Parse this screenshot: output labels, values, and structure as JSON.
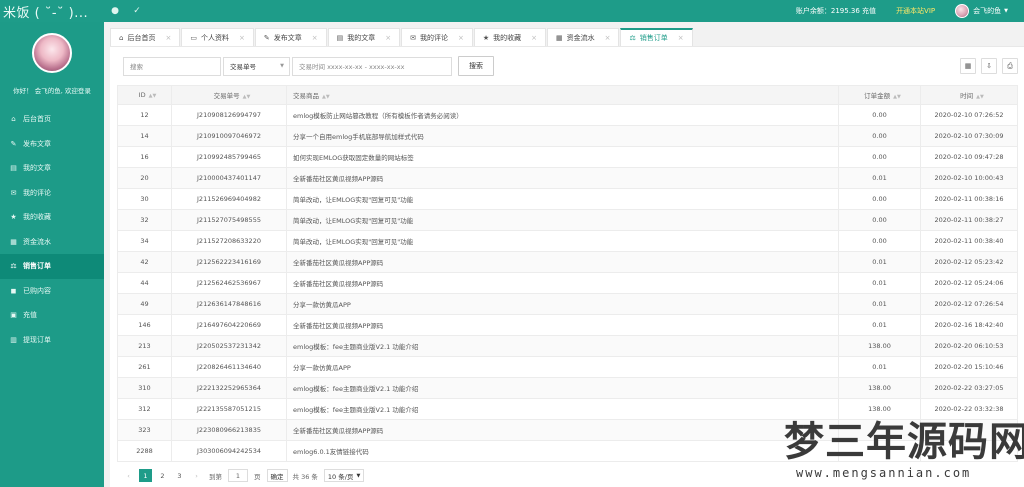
{
  "topbar": {
    "brand": "米饭 ( ˘-˘ )...",
    "icons": [
      "circle-icon",
      "check-icon"
    ],
    "balance": "账户余额：2195.36 充值",
    "vip": "开通本站VIP",
    "username": "会飞的鱼"
  },
  "sidebar": {
    "greeting": "你好！ 会飞的鱼, 欢迎登录",
    "items": [
      {
        "label": "后台首页",
        "icon": "home-icon"
      },
      {
        "label": "发布文章",
        "icon": "edit-icon"
      },
      {
        "label": "我的文章",
        "icon": "book-icon"
      },
      {
        "label": "我的评论",
        "icon": "comment-icon"
      },
      {
        "label": "我的收藏",
        "icon": "star-icon"
      },
      {
        "label": "资金流水",
        "icon": "calculator-icon"
      },
      {
        "label": "销售订单",
        "icon": "balance-icon",
        "active": true
      },
      {
        "label": "已购内容",
        "icon": "bag-icon"
      },
      {
        "label": "充值",
        "icon": "lock-icon"
      },
      {
        "label": "提现订单",
        "icon": "wallet-icon"
      }
    ]
  },
  "tabs": [
    {
      "label": "后台首页",
      "icon": "home-icon"
    },
    {
      "label": "个人资料",
      "icon": "card-icon"
    },
    {
      "label": "发布文章",
      "icon": "edit-icon"
    },
    {
      "label": "我的文章",
      "icon": "book-icon"
    },
    {
      "label": "我的评论",
      "icon": "comment-icon"
    },
    {
      "label": "我的收藏",
      "icon": "star-icon"
    },
    {
      "label": "资金流水",
      "icon": "calculator-icon"
    },
    {
      "label": "销售订单",
      "icon": "balance-icon",
      "active": true
    }
  ],
  "search": {
    "keyword_placeholder": "搜索",
    "field_select": "交易单号",
    "time_placeholder": "交易时间 xxxx-xx-xx - xxxx-xx-xx",
    "button": "搜索"
  },
  "table": {
    "headers": [
      "ID",
      "交易单号",
      "交易商品",
      "订单金额",
      "时间"
    ],
    "rows": [
      [
        "12",
        "J210908126994797",
        "emlog模板防止网站篡改教程（所有模板作者请务必阅读）",
        "0.00",
        "2020-02-10 07:26:52"
      ],
      [
        "14",
        "J210910097046972",
        "分享一个自用emlog手机底部导航加样式代码",
        "0.00",
        "2020-02-10 07:30:09"
      ],
      [
        "16",
        "J210992485799465",
        "如何实现EMLOG获取固定数量的网站标签",
        "0.00",
        "2020-02-10 09:47:28"
      ],
      [
        "20",
        "J210000437401147",
        "全新番茄社区黄瓜视频APP源码",
        "0.01",
        "2020-02-10 10:00:43"
      ],
      [
        "30",
        "J211526969404982",
        "简单改动，让EMLOG实现\"回复可见\"功能",
        "0.00",
        "2020-02-11 00:38:16"
      ],
      [
        "32",
        "J211527075498555",
        "简单改动，让EMLOG实现\"回复可见\"功能",
        "0.00",
        "2020-02-11 00:38:27"
      ],
      [
        "34",
        "J211527208633220",
        "简单改动，让EMLOG实现\"回复可见\"功能",
        "0.00",
        "2020-02-11 00:38:40"
      ],
      [
        "42",
        "J212562223416169",
        "全新番茄社区黄瓜视频APP源码",
        "0.01",
        "2020-02-12 05:23:42"
      ],
      [
        "44",
        "J212562462536967",
        "全新番茄社区黄瓜视频APP源码",
        "0.01",
        "2020-02-12 05:24:06"
      ],
      [
        "49",
        "J212636147848616",
        "分享一款仿黄瓜APP",
        "0.01",
        "2020-02-12 07:26:54"
      ],
      [
        "146",
        "J216497604220669",
        "全新番茄社区黄瓜视频APP源码",
        "0.01",
        "2020-02-16 18:42:40"
      ],
      [
        "213",
        "J220502537231342",
        "emlog模板：fee主题商业版V2.1 功能介绍",
        "138.00",
        "2020-02-20 06:10:53"
      ],
      [
        "261",
        "J220826461134640",
        "分享一款仿黄瓜APP",
        "0.01",
        "2020-02-20 15:10:46"
      ],
      [
        "310",
        "J222132252965364",
        "emlog模板：fee主题商业版V2.1 功能介绍",
        "138.00",
        "2020-02-22 03:27:05"
      ],
      [
        "312",
        "J222135587051215",
        "emlog模板：fee主题商业版V2.1 功能介绍",
        "138.00",
        "2020-02-22 03:32:38"
      ],
      [
        "323",
        "J223080966213835",
        "全新番茄社区黄瓜视频APP源码",
        "",
        ""
      ],
      [
        "2288",
        "J303006094242534",
        "emlog6.0.1友情链接代码",
        "",
        ""
      ]
    ]
  },
  "pager": {
    "pages": [
      "1",
      "2",
      "3"
    ],
    "goto_label": "到第",
    "goto_value": "1",
    "page_label": "页",
    "confirm": "确定",
    "total": "共 36 条",
    "size": "10 条/页"
  },
  "watermark": {
    "title": "梦三年源码网",
    "url": "www.mengsannian.com"
  },
  "colors": {
    "accent": "#1e9c89",
    "sidebar": "#1d9b88",
    "active_menu": "#0e8a78"
  }
}
